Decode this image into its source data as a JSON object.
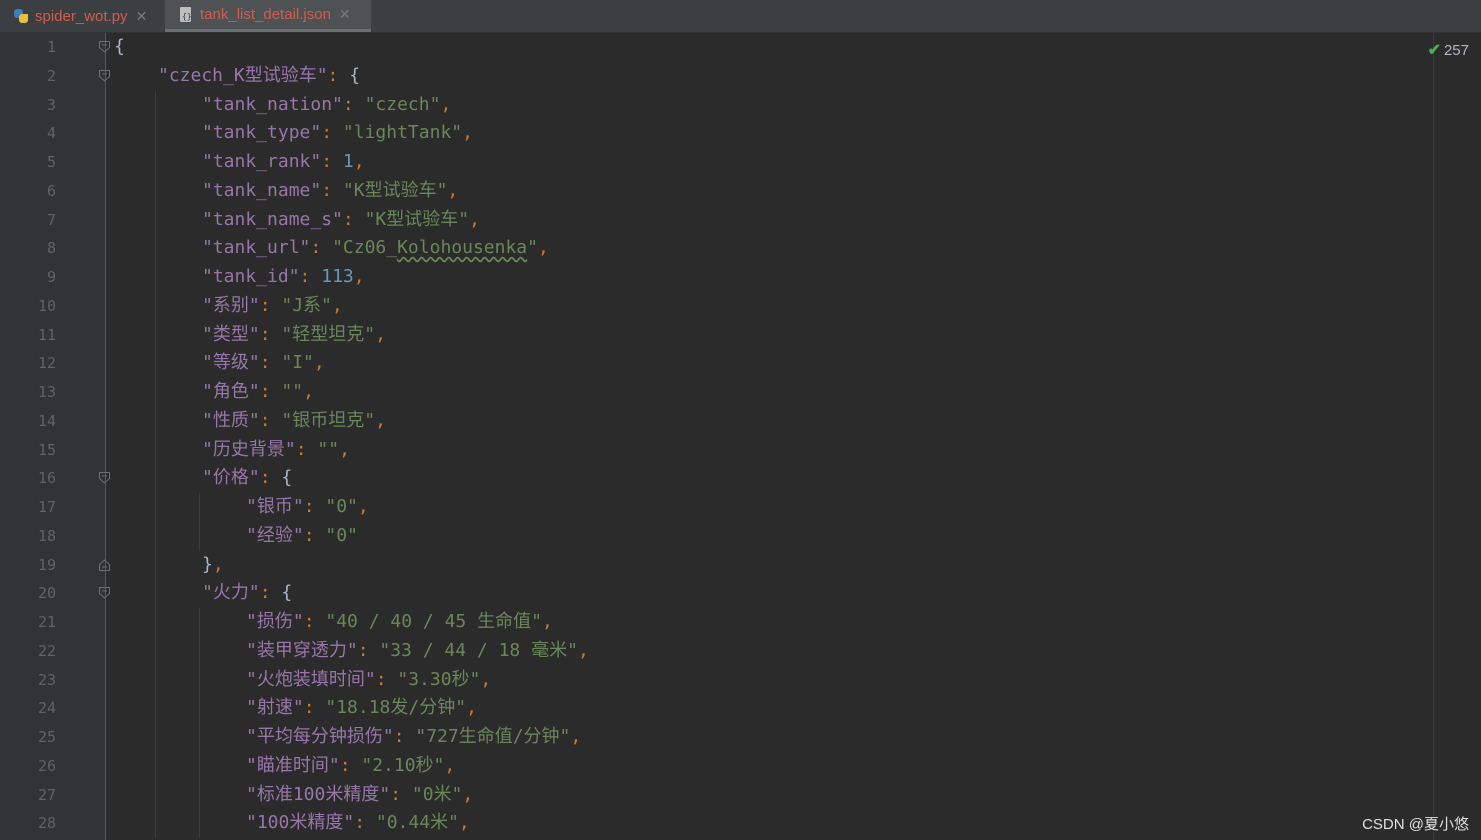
{
  "tabs": [
    {
      "label": "spider_wot.py",
      "icon": "python-file-icon",
      "active": false
    },
    {
      "label": "tank_list_detail.json",
      "icon": "json-file-icon",
      "active": true
    }
  ],
  "editor": {
    "inspection_count": "257",
    "lines": [
      [
        {
          "t": "{",
          "c": "b"
        }
      ],
      [
        {
          "t": "\"czech_K型试验车\"",
          "c": "k"
        },
        {
          "t": ": ",
          "c": "p"
        },
        {
          "t": "{",
          "c": "b"
        }
      ],
      [
        {
          "t": "\"tank_nation\"",
          "c": "k"
        },
        {
          "t": ": ",
          "c": "p"
        },
        {
          "t": "\"czech\"",
          "c": "s"
        },
        {
          "t": ",",
          "c": "p"
        }
      ],
      [
        {
          "t": "\"tank_type\"",
          "c": "k"
        },
        {
          "t": ": ",
          "c": "p"
        },
        {
          "t": "\"lightTank\"",
          "c": "s"
        },
        {
          "t": ",",
          "c": "p"
        }
      ],
      [
        {
          "t": "\"tank_rank\"",
          "c": "k"
        },
        {
          "t": ": ",
          "c": "p"
        },
        {
          "t": "1",
          "c": "n"
        },
        {
          "t": ",",
          "c": "p"
        }
      ],
      [
        {
          "t": "\"tank_name\"",
          "c": "k"
        },
        {
          "t": ": ",
          "c": "p"
        },
        {
          "t": "\"K型试验车\"",
          "c": "s"
        },
        {
          "t": ",",
          "c": "p"
        }
      ],
      [
        {
          "t": "\"tank_name_s\"",
          "c": "k"
        },
        {
          "t": ": ",
          "c": "p"
        },
        {
          "t": "\"K型试验车\"",
          "c": "s"
        },
        {
          "t": ",",
          "c": "p"
        }
      ],
      [
        {
          "t": "\"tank_url\"",
          "c": "k"
        },
        {
          "t": ": ",
          "c": "p"
        },
        {
          "t": "\"Cz06_",
          "c": "s"
        },
        {
          "t": "Kolohousenka",
          "c": "s u"
        },
        {
          "t": "\"",
          "c": "s"
        },
        {
          "t": ",",
          "c": "p"
        }
      ],
      [
        {
          "t": "\"tank_id\"",
          "c": "k"
        },
        {
          "t": ": ",
          "c": "p"
        },
        {
          "t": "113",
          "c": "n"
        },
        {
          "t": ",",
          "c": "p"
        }
      ],
      [
        {
          "t": "\"系别\"",
          "c": "k"
        },
        {
          "t": ": ",
          "c": "p"
        },
        {
          "t": "\"J系\"",
          "c": "s"
        },
        {
          "t": ",",
          "c": "p"
        }
      ],
      [
        {
          "t": "\"类型\"",
          "c": "k"
        },
        {
          "t": ": ",
          "c": "p"
        },
        {
          "t": "\"轻型坦克\"",
          "c": "s"
        },
        {
          "t": ",",
          "c": "p"
        }
      ],
      [
        {
          "t": "\"等级\"",
          "c": "k"
        },
        {
          "t": ": ",
          "c": "p"
        },
        {
          "t": "\"I\"",
          "c": "s"
        },
        {
          "t": ",",
          "c": "p"
        }
      ],
      [
        {
          "t": "\"角色\"",
          "c": "k"
        },
        {
          "t": ": ",
          "c": "p"
        },
        {
          "t": "\"\"",
          "c": "s"
        },
        {
          "t": ",",
          "c": "p"
        }
      ],
      [
        {
          "t": "\"性质\"",
          "c": "k"
        },
        {
          "t": ": ",
          "c": "p"
        },
        {
          "t": "\"银币坦克\"",
          "c": "s"
        },
        {
          "t": ",",
          "c": "p"
        }
      ],
      [
        {
          "t": "\"历史背景\"",
          "c": "k"
        },
        {
          "t": ": ",
          "c": "p"
        },
        {
          "t": "\"\"",
          "c": "s"
        },
        {
          "t": ",",
          "c": "p"
        }
      ],
      [
        {
          "t": "\"价格\"",
          "c": "k"
        },
        {
          "t": ": ",
          "c": "p"
        },
        {
          "t": "{",
          "c": "b"
        }
      ],
      [
        {
          "t": "\"银币\"",
          "c": "k"
        },
        {
          "t": ": ",
          "c": "p"
        },
        {
          "t": "\"0\"",
          "c": "s"
        },
        {
          "t": ",",
          "c": "p"
        }
      ],
      [
        {
          "t": "\"经验\"",
          "c": "k"
        },
        {
          "t": ": ",
          "c": "p"
        },
        {
          "t": "\"0\"",
          "c": "s"
        }
      ],
      [
        {
          "t": "}",
          "c": "b"
        },
        {
          "t": ",",
          "c": "p"
        }
      ],
      [
        {
          "t": "\"火力\"",
          "c": "k"
        },
        {
          "t": ": ",
          "c": "p"
        },
        {
          "t": "{",
          "c": "b"
        }
      ],
      [
        {
          "t": "\"损伤\"",
          "c": "k"
        },
        {
          "t": ": ",
          "c": "p"
        },
        {
          "t": "\"40 / 40 / 45 生命值\"",
          "c": "s"
        },
        {
          "t": ",",
          "c": "p"
        }
      ],
      [
        {
          "t": "\"装甲穿透力\"",
          "c": "k"
        },
        {
          "t": ": ",
          "c": "p"
        },
        {
          "t": "\"33 / 44 / 18 毫米\"",
          "c": "s"
        },
        {
          "t": ",",
          "c": "p"
        }
      ],
      [
        {
          "t": "\"火炮装填时间\"",
          "c": "k"
        },
        {
          "t": ": ",
          "c": "p"
        },
        {
          "t": "\"3.30秒\"",
          "c": "s"
        },
        {
          "t": ",",
          "c": "p"
        }
      ],
      [
        {
          "t": "\"射速\"",
          "c": "k"
        },
        {
          "t": ": ",
          "c": "p"
        },
        {
          "t": "\"18.18发/分钟\"",
          "c": "s"
        },
        {
          "t": ",",
          "c": "p"
        }
      ],
      [
        {
          "t": "\"平均每分钟损伤\"",
          "c": "k"
        },
        {
          "t": ": ",
          "c": "p"
        },
        {
          "t": "\"727生命值/分钟\"",
          "c": "s"
        },
        {
          "t": ",",
          "c": "p"
        }
      ],
      [
        {
          "t": "\"瞄准时间\"",
          "c": "k"
        },
        {
          "t": ": ",
          "c": "p"
        },
        {
          "t": "\"2.10秒\"",
          "c": "s"
        },
        {
          "t": ",",
          "c": "p"
        }
      ],
      [
        {
          "t": "\"标准100米精度\"",
          "c": "k"
        },
        {
          "t": ": ",
          "c": "p"
        },
        {
          "t": "\"0米\"",
          "c": "s"
        },
        {
          "t": ",",
          "c": "p"
        }
      ],
      [
        {
          "t": "\"100米精度\"",
          "c": "k"
        },
        {
          "t": ": ",
          "c": "p"
        },
        {
          "t": "\"0.44米\"",
          "c": "s"
        },
        {
          "t": ",",
          "c": "p"
        }
      ]
    ]
  },
  "watermark": "CSDN @夏小悠"
}
